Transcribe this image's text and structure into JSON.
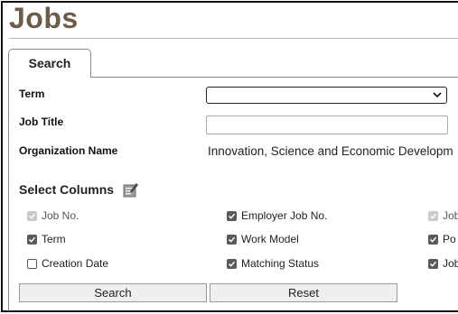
{
  "page": {
    "title": "Jobs"
  },
  "tabs": [
    {
      "label": "Search"
    }
  ],
  "form": {
    "term_label": "Term",
    "term_value": "",
    "job_title_label": "Job Title",
    "job_title_value": "",
    "org_label": "Organization Name",
    "org_value": "Innovation, Science and Economic Developm"
  },
  "columns": {
    "heading": "Select Columns",
    "edit_icon": "edit-note-icon",
    "items": [
      {
        "label": "Job No.",
        "checked": true,
        "disabled": true
      },
      {
        "label": "Employer Job No.",
        "checked": true,
        "disabled": false
      },
      {
        "label": "Job",
        "checked": true,
        "disabled": true
      },
      {
        "label": "Term",
        "checked": true,
        "disabled": false
      },
      {
        "label": "Work Model",
        "checked": true,
        "disabled": false
      },
      {
        "label": "Po",
        "checked": true,
        "disabled": false
      },
      {
        "label": "Creation Date",
        "checked": false,
        "disabled": false
      },
      {
        "label": "Matching Status",
        "checked": true,
        "disabled": false
      },
      {
        "label": "Job",
        "checked": true,
        "disabled": false
      }
    ]
  },
  "buttons": {
    "search": "Search",
    "reset": "Reset"
  },
  "colors": {
    "title": "#6b5d49",
    "checkbox_checked": "#5a5a5a",
    "checkbox_disabled": "#c9c9c9"
  }
}
